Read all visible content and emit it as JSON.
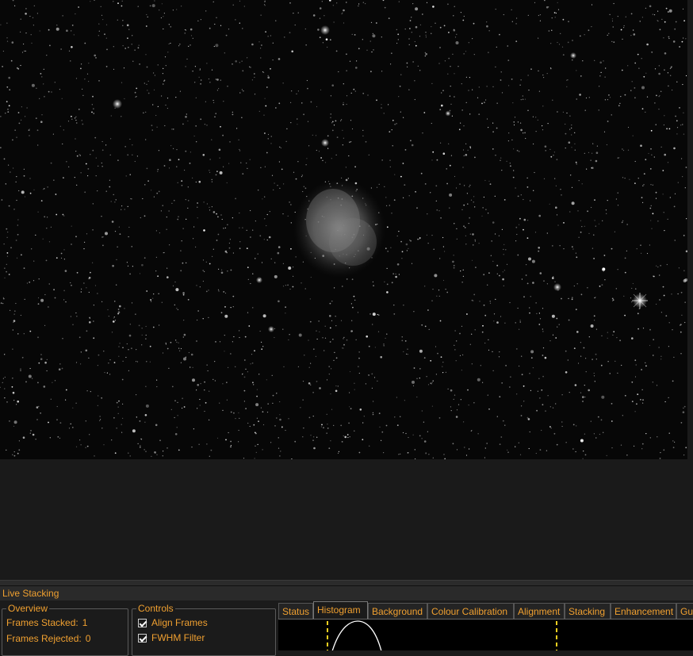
{
  "viewer": {
    "image_subject": "Dumbbell Nebula (M27) star field"
  },
  "live_stacking": {
    "title": "Live Stacking",
    "overview": {
      "legend": "Overview",
      "frames_stacked_label": "Frames Stacked:",
      "frames_stacked_value": "1",
      "frames_rejected_label": "Frames Rejected:",
      "frames_rejected_value": "0"
    },
    "controls": {
      "legend": "Controls",
      "align_frames_label": "Align Frames",
      "align_frames_checked": true,
      "fwhm_filter_label": "FWHM Filter",
      "fwhm_filter_checked": true
    },
    "tabs": [
      {
        "label": "Status",
        "active": false
      },
      {
        "label": "Histogram",
        "active": true
      },
      {
        "label": "Background",
        "active": false
      },
      {
        "label": "Colour Calibration",
        "active": false
      },
      {
        "label": "Alignment",
        "active": false
      },
      {
        "label": "Stacking",
        "active": false
      },
      {
        "label": "Enhancement",
        "active": false
      },
      {
        "label": "Gu",
        "active": false
      }
    ]
  },
  "colors": {
    "accent": "#f0a030",
    "background": "#1b1b1b",
    "marker": "#f5d020"
  }
}
